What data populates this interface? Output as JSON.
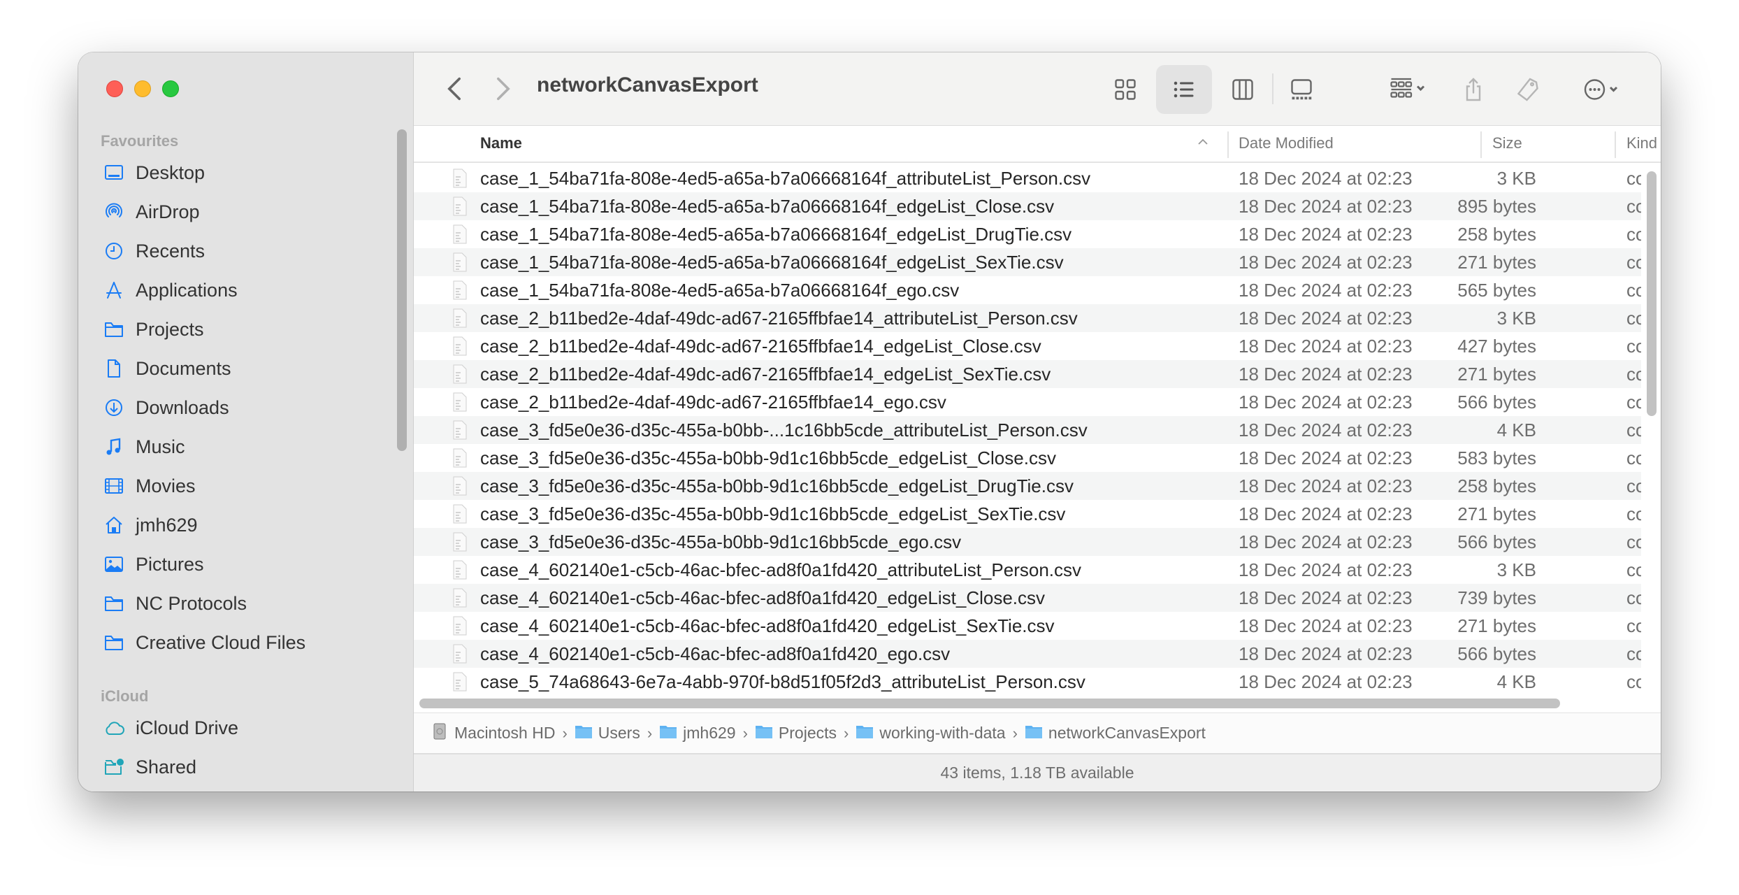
{
  "window": {
    "title": "networkCanvasExport",
    "traffic_lights": [
      "close",
      "minimize",
      "zoom"
    ]
  },
  "sidebar": {
    "sections": [
      {
        "label": "Favourites",
        "items": [
          {
            "label": "Desktop",
            "icon": "desktop-icon"
          },
          {
            "label": "AirDrop",
            "icon": "airdrop-icon"
          },
          {
            "label": "Recents",
            "icon": "clock-icon"
          },
          {
            "label": "Applications",
            "icon": "applications-icon"
          },
          {
            "label": "Projects",
            "icon": "folder-icon"
          },
          {
            "label": "Documents",
            "icon": "document-icon"
          },
          {
            "label": "Downloads",
            "icon": "download-icon"
          },
          {
            "label": "Music",
            "icon": "music-note-icon"
          },
          {
            "label": "Movies",
            "icon": "film-icon"
          },
          {
            "label": "jmh629",
            "icon": "home-icon"
          },
          {
            "label": "Pictures",
            "icon": "photo-icon"
          },
          {
            "label": "NC Protocols",
            "icon": "folder-icon"
          },
          {
            "label": "Creative Cloud Files",
            "icon": "folder-icon"
          }
        ]
      },
      {
        "label": "iCloud",
        "items": [
          {
            "label": "iCloud Drive",
            "icon": "cloud-icon"
          },
          {
            "label": "Shared",
            "icon": "shared-folder-icon"
          }
        ]
      }
    ]
  },
  "toolbar": {
    "back": "chevron-left-icon",
    "forward": "chevron-right-icon",
    "views": [
      "icon-view",
      "list-view",
      "column-view",
      "gallery-view"
    ],
    "active_view": "list-view",
    "group": "group-by-icon",
    "share": "share-icon",
    "tag": "tag-icon",
    "more": "ellipsis-circle-icon",
    "search": "search-icon"
  },
  "columns": {
    "name": "Name",
    "date": "Date Modified",
    "size": "Size",
    "kind": "Kind",
    "sorted_by": "Name",
    "sort_direction": "ascending"
  },
  "files": [
    {
      "name": "case_1_54ba71fa-808e-4ed5-a65a-b7a06668164f_attributeList_Person.csv",
      "date": "18 Dec 2024 at 02:23",
      "size": "3 KB",
      "kind": "comma...va"
    },
    {
      "name": "case_1_54ba71fa-808e-4ed5-a65a-b7a06668164f_edgeList_Close.csv",
      "date": "18 Dec 2024 at 02:23",
      "size": "895 bytes",
      "kind": "comma...va"
    },
    {
      "name": "case_1_54ba71fa-808e-4ed5-a65a-b7a06668164f_edgeList_DrugTie.csv",
      "date": "18 Dec 2024 at 02:23",
      "size": "258 bytes",
      "kind": "comma...va"
    },
    {
      "name": "case_1_54ba71fa-808e-4ed5-a65a-b7a06668164f_edgeList_SexTie.csv",
      "date": "18 Dec 2024 at 02:23",
      "size": "271 bytes",
      "kind": "comma...va"
    },
    {
      "name": "case_1_54ba71fa-808e-4ed5-a65a-b7a06668164f_ego.csv",
      "date": "18 Dec 2024 at 02:23",
      "size": "565 bytes",
      "kind": "comma...va"
    },
    {
      "name": "case_2_b11bed2e-4daf-49dc-ad67-2165ffbfae14_attributeList_Person.csv",
      "date": "18 Dec 2024 at 02:23",
      "size": "3 KB",
      "kind": "comma...va"
    },
    {
      "name": "case_2_b11bed2e-4daf-49dc-ad67-2165ffbfae14_edgeList_Close.csv",
      "date": "18 Dec 2024 at 02:23",
      "size": "427 bytes",
      "kind": "comma...va"
    },
    {
      "name": "case_2_b11bed2e-4daf-49dc-ad67-2165ffbfae14_edgeList_SexTie.csv",
      "date": "18 Dec 2024 at 02:23",
      "size": "271 bytes",
      "kind": "comma...va"
    },
    {
      "name": "case_2_b11bed2e-4daf-49dc-ad67-2165ffbfae14_ego.csv",
      "date": "18 Dec 2024 at 02:23",
      "size": "566 bytes",
      "kind": "comma...va"
    },
    {
      "name": "case_3_fd5e0e36-d35c-455a-b0bb-...1c16bb5cde_attributeList_Person.csv",
      "date": "18 Dec 2024 at 02:23",
      "size": "4 KB",
      "kind": "comma...va"
    },
    {
      "name": "case_3_fd5e0e36-d35c-455a-b0bb-9d1c16bb5cde_edgeList_Close.csv",
      "date": "18 Dec 2024 at 02:23",
      "size": "583 bytes",
      "kind": "comma...va"
    },
    {
      "name": "case_3_fd5e0e36-d35c-455a-b0bb-9d1c16bb5cde_edgeList_DrugTie.csv",
      "date": "18 Dec 2024 at 02:23",
      "size": "258 bytes",
      "kind": "comma...va"
    },
    {
      "name": "case_3_fd5e0e36-d35c-455a-b0bb-9d1c16bb5cde_edgeList_SexTie.csv",
      "date": "18 Dec 2024 at 02:23",
      "size": "271 bytes",
      "kind": "comma...va"
    },
    {
      "name": "case_3_fd5e0e36-d35c-455a-b0bb-9d1c16bb5cde_ego.csv",
      "date": "18 Dec 2024 at 02:23",
      "size": "566 bytes",
      "kind": "comma...va"
    },
    {
      "name": "case_4_602140e1-c5cb-46ac-bfec-ad8f0a1fd420_attributeList_Person.csv",
      "date": "18 Dec 2024 at 02:23",
      "size": "3 KB",
      "kind": "comma...va"
    },
    {
      "name": "case_4_602140e1-c5cb-46ac-bfec-ad8f0a1fd420_edgeList_Close.csv",
      "date": "18 Dec 2024 at 02:23",
      "size": "739 bytes",
      "kind": "comma...va"
    },
    {
      "name": "case_4_602140e1-c5cb-46ac-bfec-ad8f0a1fd420_edgeList_SexTie.csv",
      "date": "18 Dec 2024 at 02:23",
      "size": "271 bytes",
      "kind": "comma...va"
    },
    {
      "name": "case_4_602140e1-c5cb-46ac-bfec-ad8f0a1fd420_ego.csv",
      "date": "18 Dec 2024 at 02:23",
      "size": "566 bytes",
      "kind": "comma...va"
    },
    {
      "name": "case_5_74a68643-6e7a-4abb-970f-b8d51f05f2d3_attributeList_Person.csv",
      "date": "18 Dec 2024 at 02:23",
      "size": "4 KB",
      "kind": "comma...va"
    }
  ],
  "pathbar": [
    {
      "label": "Macintosh HD",
      "icon": "hard-drive-icon"
    },
    {
      "label": "Users",
      "icon": "folder-icon"
    },
    {
      "label": "jmh629",
      "icon": "home-folder-icon"
    },
    {
      "label": "Projects",
      "icon": "folder-icon"
    },
    {
      "label": "working-with-data",
      "icon": "folder-icon"
    },
    {
      "label": "networkCanvasExport",
      "icon": "folder-icon"
    }
  ],
  "status": "43 items, 1.18 TB available",
  "colors": {
    "accent": "#1a7cf5",
    "icloud": "#21a5b8",
    "sidebar_bg": "#e3e3e3",
    "toolbar_bg": "#f3f3f2",
    "row_alt": "#f4f5f5"
  }
}
